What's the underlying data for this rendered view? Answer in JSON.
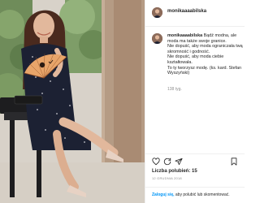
{
  "post": {
    "username": "monikaaaabilska",
    "caption": {
      "username": "monikaaaabilska",
      "lines": [
        "Bądź modna, ale",
        "moda ma także swoje granice.",
        "Nie dopuść, aby moda ograniczała twą",
        "skromność i godność.",
        "Nie dopuść, aby moda ciebie",
        "kształtowała.",
        "To ty tworzysz modę. (ks. kard. Stefan",
        "Wyszyński)"
      ],
      "caption_first": "Bądź modna, ale",
      "line2": "moda ma także swoje granice.",
      "line3": "Nie dopuść, aby moda ograniczała twą",
      "line4": "skromność i godność.",
      "line5": "Nie dopuść, aby moda ciebie",
      "line6": "kształtowała.",
      "line7": "To ty tworzysz modę. (ks. kard. Stefan",
      "line8": "Wyszyński)"
    },
    "caption_meta": "138 tyg.",
    "likes_text": "Liczba polubień: 15",
    "date": "12 GRUDNIA 2018",
    "login": {
      "link": "Zaloguj się,",
      "rest": " aby polubić lub skomentować."
    },
    "icons": [
      "heart-icon",
      "comment-icon",
      "share-icon",
      "bookmark-icon"
    ]
  }
}
